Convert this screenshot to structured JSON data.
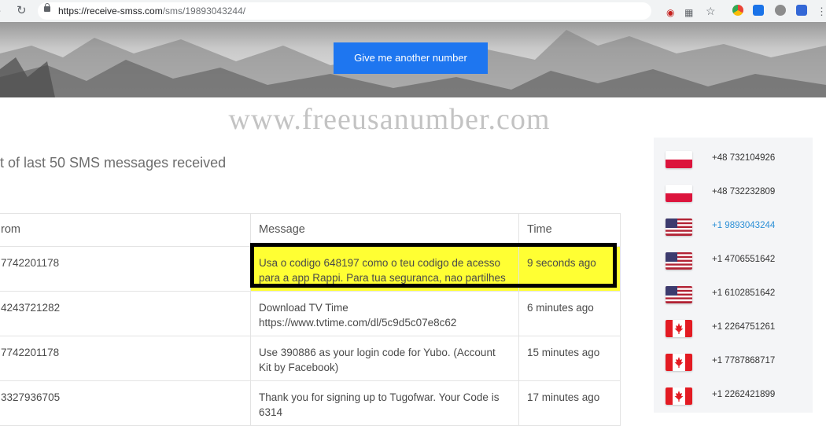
{
  "browser": {
    "url_prefix": "https://receive-smss.com",
    "url_path": "/sms/19893043244/"
  },
  "hero": {
    "cta_label": "Give me another number"
  },
  "watermark": "www.freeusanumber.com",
  "section_title": "t of last 50 SMS messages received",
  "table": {
    "headers": {
      "from": "rom",
      "message": "Message",
      "time": "Time"
    },
    "rows": [
      {
        "from": "7742201178",
        "message": "Usa o codigo 648197 como o teu codigo de acesso para a app Rappi. Para tua seguranca, nao partilhes",
        "time": "9 seconds ago",
        "highlighted": true
      },
      {
        "from": "4243721282",
        "message": "Download TV Time https://www.tvtime.com/dl/5c9d5c07e8c62",
        "time": "6 minutes ago"
      },
      {
        "from": "7742201178",
        "message": "Use 390886 as your login code for Yubo. (Account Kit by Facebook)",
        "time": "15 minutes ago"
      },
      {
        "from": "3327936705",
        "message": "Thank you for signing up to Tugofwar. Your Code is 6314",
        "time": "17 minutes ago"
      }
    ]
  },
  "sidebar": {
    "numbers": [
      {
        "flag": "poland-flag",
        "number": "+48 732104926"
      },
      {
        "flag": "poland-flag",
        "number": "+48 732232809"
      },
      {
        "flag": "usa-flag",
        "number": "+1 9893043244",
        "active": true
      },
      {
        "flag": "usa-flag",
        "number": "+1 4706551642"
      },
      {
        "flag": "usa-flag",
        "number": "+1 6102851642"
      },
      {
        "flag": "canada-flag",
        "number": "+1 2264751261"
      },
      {
        "flag": "canada-flag",
        "number": "+1 7787868717"
      },
      {
        "flag": "canada-flag",
        "number": "+1 2262421899"
      }
    ]
  },
  "colors": {
    "accent": "#1e76f0",
    "highlight": "#ffff33",
    "active_link": "#2b8fd6"
  }
}
